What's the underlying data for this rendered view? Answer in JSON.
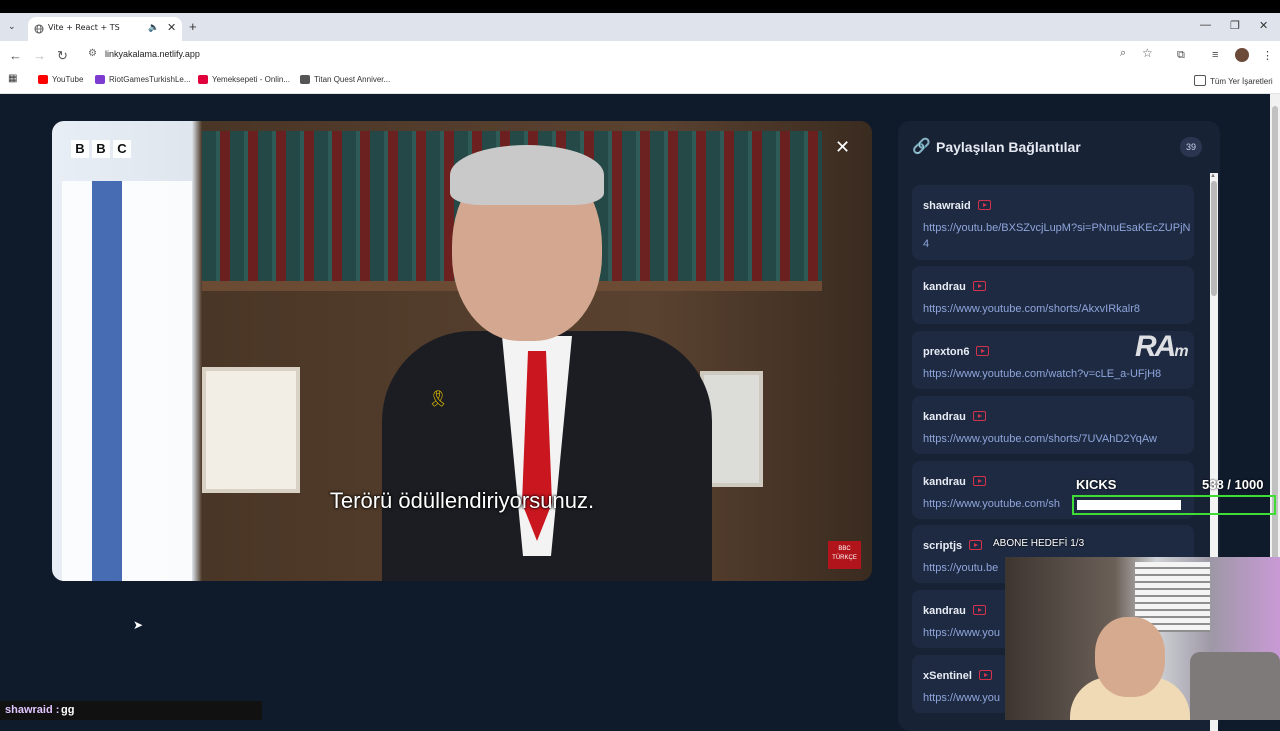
{
  "browser": {
    "tab_title": "Vite + React + TS",
    "url": "linkyakalama.netlify.app",
    "bookmarks": [
      "YouTube",
      "RiotGamesTurkishLe...",
      "Yemeksepeti - Onlin...",
      "Titan Quest Anniver..."
    ],
    "all_bookmarks": "Tüm Yer İşaretleri",
    "bookmark_colors": [
      "#ff0000",
      "#7e3bd0",
      "#e2003c",
      "#555555"
    ]
  },
  "video": {
    "subtitle": "Terörü ödüllendiriyorsunuz.",
    "logo_letters": [
      "B",
      "B",
      "C"
    ],
    "corner_logo": "BBC TÜRKÇE"
  },
  "panel": {
    "title": "Paylaşılan Bağlantılar",
    "count": "39",
    "items": [
      {
        "user": "shawraid",
        "link": "https://youtu.be/BXSZvcjLupM?si=PNnuEsaKEcZUPjN4"
      },
      {
        "user": "kandrau",
        "link": "https://www.youtube.com/shorts/AkxvIRkalr8"
      },
      {
        "user": "prexton6",
        "link": "https://www.youtube.com/watch?v=cLE_a-UFjH8"
      },
      {
        "user": "kandrau",
        "link": "https://www.youtube.com/shorts/7UVAhD2YqAw"
      },
      {
        "user": "kandrau",
        "link": "https://www.youtube.com/sh"
      },
      {
        "user": "scriptjs",
        "link": "https://youtu.be"
      },
      {
        "user": "kandrau",
        "link": "https://www.you"
      },
      {
        "user": "xSentinel",
        "link": "https://www.you"
      }
    ]
  },
  "overlay": {
    "watermark": "RA",
    "watermark_small": "m",
    "kicks_label": "KICKS",
    "kicks_count": "538  / 1000",
    "kicks_progress": 0.538,
    "abone": "ABONE HEDEFİ  1/3",
    "chat_user": "shawraid :",
    "chat_msg": "gg"
  }
}
